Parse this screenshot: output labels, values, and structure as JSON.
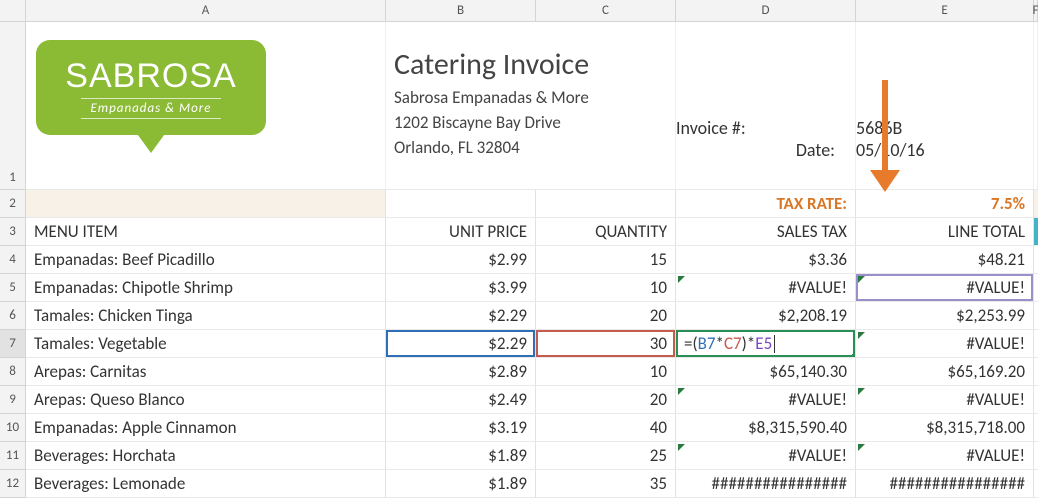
{
  "columns": [
    "A",
    "B",
    "C",
    "D",
    "E",
    "F"
  ],
  "logo": {
    "main": "SABROSA",
    "sub": "Empanadas & More"
  },
  "header": {
    "title": "Catering Invoice",
    "company": "Sabrosa Empanadas & More",
    "addr1": "1202 Biscayne Bay Drive",
    "addr2": "Orlando, FL 32804",
    "invoice_no_label": "Invoice #:",
    "invoice_no": "5686B",
    "date_label": "Date:",
    "date": "05/10/16"
  },
  "tax": {
    "label": "TAX RATE:",
    "value": "7.5%"
  },
  "table_headers": {
    "a": "MENU ITEM",
    "b": "UNIT PRICE",
    "c": "QUANTITY",
    "d": "SALES TAX",
    "e": "LINE TOTAL"
  },
  "formula": {
    "raw": "=(B7*C7)*E5",
    "eq": "=(",
    "b": "B7",
    "sep1": "*",
    "c": "C7",
    "sep2": ")*",
    "e": "E5"
  },
  "rows": [
    {
      "n": "4",
      "item": "Empanadas: Beef Picadillo",
      "price": "$2.99",
      "qty": "15",
      "tax": "$3.36",
      "total": "$48.21"
    },
    {
      "n": "5",
      "item": "Empanadas: Chipotle Shrimp",
      "price": "$3.99",
      "qty": "10",
      "tax": "#VALUE!",
      "total": "#VALUE!"
    },
    {
      "n": "6",
      "item": "Tamales: Chicken Tinga",
      "price": "$2.29",
      "qty": "20",
      "tax": "$2,208.19",
      "total": "$2,253.99"
    },
    {
      "n": "7",
      "item": "Tamales: Vegetable",
      "price": "$2.29",
      "qty": "30",
      "tax": "",
      "total": "#VALUE!"
    },
    {
      "n": "8",
      "item": "Arepas: Carnitas",
      "price": "$2.89",
      "qty": "10",
      "tax": "$65,140.30",
      "total": "$65,169.20"
    },
    {
      "n": "9",
      "item": "Arepas: Queso Blanco",
      "price": "$2.49",
      "qty": "20",
      "tax": "#VALUE!",
      "total": "#VALUE!"
    },
    {
      "n": "10",
      "item": "Empanadas: Apple Cinnamon",
      "price": "$3.19",
      "qty": "40",
      "tax": "$8,315,590.40",
      "total": "$8,315,718.00"
    },
    {
      "n": "11",
      "item": "Beverages: Horchata",
      "price": "$1.89",
      "qty": "25",
      "tax": "#VALUE!",
      "total": "#VALUE!"
    },
    {
      "n": "12",
      "item": "Beverages: Lemonade",
      "price": "$1.89",
      "qty": "35",
      "tax": "################",
      "total": "################"
    }
  ],
  "chart_data": {
    "type": "table",
    "title": "Catering Invoice",
    "headers": [
      "MENU ITEM",
      "UNIT PRICE",
      "QUANTITY",
      "SALES TAX",
      "LINE TOTAL"
    ],
    "tax_rate_percent": 7.5,
    "rows": [
      {
        "item": "Empanadas: Beef Picadillo",
        "unit_price": 2.99,
        "quantity": 15,
        "sales_tax": 3.36,
        "line_total": 48.21
      },
      {
        "item": "Empanadas: Chipotle Shrimp",
        "unit_price": 3.99,
        "quantity": 10,
        "sales_tax": "#VALUE!",
        "line_total": "#VALUE!"
      },
      {
        "item": "Tamales: Chicken Tinga",
        "unit_price": 2.29,
        "quantity": 20,
        "sales_tax": 2208.19,
        "line_total": 2253.99
      },
      {
        "item": "Tamales: Vegetable",
        "unit_price": 2.29,
        "quantity": 30,
        "sales_tax": "=(B7*C7)*E5",
        "line_total": "#VALUE!"
      },
      {
        "item": "Arepas: Carnitas",
        "unit_price": 2.89,
        "quantity": 10,
        "sales_tax": 65140.3,
        "line_total": 65169.2
      },
      {
        "item": "Arepas: Queso Blanco",
        "unit_price": 2.49,
        "quantity": 20,
        "sales_tax": "#VALUE!",
        "line_total": "#VALUE!"
      },
      {
        "item": "Empanadas: Apple Cinnamon",
        "unit_price": 3.19,
        "quantity": 40,
        "sales_tax": 8315590.4,
        "line_total": 8315718.0
      },
      {
        "item": "Beverages: Horchata",
        "unit_price": 1.89,
        "quantity": 25,
        "sales_tax": "#VALUE!",
        "line_total": "#VALUE!"
      },
      {
        "item": "Beverages: Lemonade",
        "unit_price": 1.89,
        "quantity": 35,
        "sales_tax": "####",
        "line_total": "####"
      }
    ]
  }
}
